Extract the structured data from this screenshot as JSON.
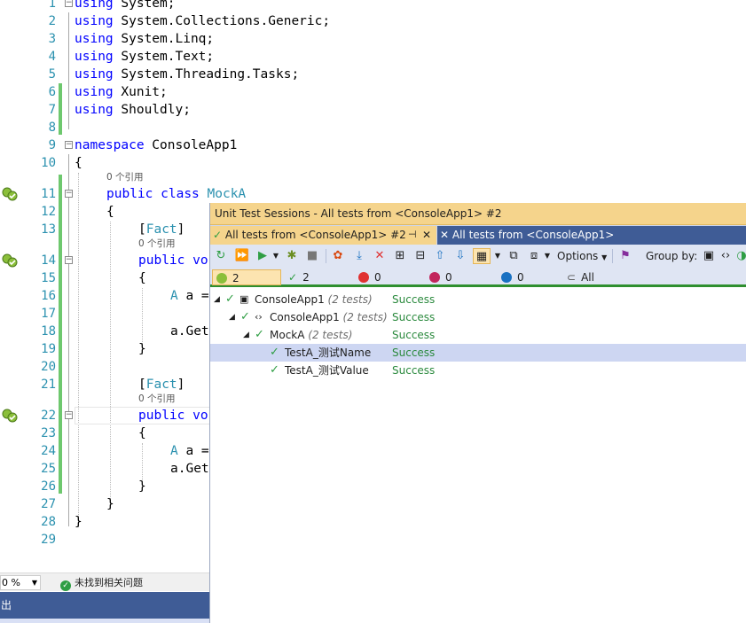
{
  "editor": {
    "lines": [
      {
        "n": "1",
        "indent": 0,
        "tokens": [
          {
            "t": "using",
            "c": "kw"
          },
          {
            "t": " System;",
            "c": ""
          }
        ]
      },
      {
        "n": "2",
        "indent": 0,
        "tokens": [
          {
            "t": "using",
            "c": "kw"
          },
          {
            "t": " System.Collections.Generic;",
            "c": ""
          }
        ]
      },
      {
        "n": "3",
        "indent": 0,
        "tokens": [
          {
            "t": "using",
            "c": "kw"
          },
          {
            "t": " System.Linq;",
            "c": ""
          }
        ]
      },
      {
        "n": "4",
        "indent": 0,
        "tokens": [
          {
            "t": "using",
            "c": "kw"
          },
          {
            "t": " System.Text;",
            "c": ""
          }
        ]
      },
      {
        "n": "5",
        "indent": 0,
        "tokens": [
          {
            "t": "using",
            "c": "kw"
          },
          {
            "t": " System.Threading.Tasks;",
            "c": ""
          }
        ]
      },
      {
        "n": "6",
        "indent": 0,
        "tokens": [
          {
            "t": "using",
            "c": "kw"
          },
          {
            "t": " Xunit;",
            "c": ""
          }
        ]
      },
      {
        "n": "7",
        "indent": 0,
        "tokens": [
          {
            "t": "using",
            "c": "kw"
          },
          {
            "t": " Shouldly;",
            "c": ""
          }
        ]
      },
      {
        "n": "8",
        "indent": 0,
        "tokens": []
      },
      {
        "n": "9",
        "indent": 0,
        "tokens": [
          {
            "t": "namespace",
            "c": "kw"
          },
          {
            "t": " ConsoleApp1",
            "c": ""
          }
        ]
      },
      {
        "n": "10",
        "indent": 0,
        "tokens": [
          {
            "t": "{",
            "c": ""
          }
        ]
      },
      {
        "n": "11",
        "indent": 1,
        "tokens": [
          {
            "t": "public",
            "c": "kw"
          },
          {
            "t": " ",
            "c": ""
          },
          {
            "t": "class",
            "c": "kw"
          },
          {
            "t": " ",
            "c": ""
          },
          {
            "t": "MockA",
            "c": "type"
          }
        ]
      },
      {
        "n": "12",
        "indent": 1,
        "tokens": [
          {
            "t": "{",
            "c": ""
          }
        ]
      },
      {
        "n": "13",
        "indent": 2,
        "tokens": [
          {
            "t": "[",
            "c": ""
          },
          {
            "t": "Fact",
            "c": "type"
          },
          {
            "t": "]",
            "c": ""
          }
        ]
      },
      {
        "n": "14",
        "indent": 2,
        "tokens": [
          {
            "t": "public",
            "c": "kw"
          },
          {
            "t": " vo",
            "c": "kw"
          }
        ]
      },
      {
        "n": "15",
        "indent": 2,
        "tokens": [
          {
            "t": "{",
            "c": ""
          }
        ]
      },
      {
        "n": "16",
        "indent": 3,
        "tokens": [
          {
            "t": "A",
            "c": "type"
          },
          {
            "t": " a =",
            "c": ""
          }
        ]
      },
      {
        "n": "17",
        "indent": 0,
        "tokens": []
      },
      {
        "n": "18",
        "indent": 3,
        "tokens": [
          {
            "t": "a.Get",
            "c": ""
          }
        ]
      },
      {
        "n": "19",
        "indent": 2,
        "tokens": [
          {
            "t": "}",
            "c": ""
          }
        ]
      },
      {
        "n": "20",
        "indent": 0,
        "tokens": []
      },
      {
        "n": "21",
        "indent": 2,
        "tokens": [
          {
            "t": "[",
            "c": ""
          },
          {
            "t": "Fact",
            "c": "type"
          },
          {
            "t": "]",
            "c": ""
          }
        ]
      },
      {
        "n": "22",
        "indent": 2,
        "tokens": [
          {
            "t": "public",
            "c": "kw"
          },
          {
            "t": " vo",
            "c": "kw"
          }
        ]
      },
      {
        "n": "23",
        "indent": 2,
        "tokens": [
          {
            "t": "{",
            "c": ""
          }
        ]
      },
      {
        "n": "24",
        "indent": 3,
        "tokens": [
          {
            "t": "A",
            "c": "type"
          },
          {
            "t": " a =",
            "c": ""
          }
        ]
      },
      {
        "n": "25",
        "indent": 3,
        "tokens": [
          {
            "t": "a.Get",
            "c": ""
          }
        ]
      },
      {
        "n": "26",
        "indent": 2,
        "tokens": [
          {
            "t": "}",
            "c": ""
          }
        ]
      },
      {
        "n": "27",
        "indent": 1,
        "tokens": [
          {
            "t": "}",
            "c": ""
          }
        ]
      },
      {
        "n": "28",
        "indent": 0,
        "tokens": [
          {
            "t": "}",
            "c": ""
          }
        ]
      },
      {
        "n": "29",
        "indent": 0,
        "tokens": []
      }
    ],
    "reference_label": "0 个引用"
  },
  "statusbar": {
    "zoom": "0 %",
    "issues": "未找到相关问题"
  },
  "outputbar": {
    "title": "出"
  },
  "unit_test": {
    "title": "Unit Test Sessions - All tests from <ConsoleApp1> #2",
    "tabs": [
      {
        "label": "All tests from <ConsoleApp1> #2"
      },
      {
        "label": "All tests from <ConsoleApp1>"
      }
    ],
    "toolbar": {
      "options_label": "Options",
      "group_by_label": "Group by:"
    },
    "filters": {
      "total": "2",
      "passed": "2",
      "failed": "0",
      "ignored": "0",
      "unknown": "0",
      "all": "All"
    },
    "tree": [
      {
        "name": "ConsoleApp1",
        "count": "(2 tests)",
        "status": "Success",
        "level": 0,
        "kind": "project",
        "selected": false
      },
      {
        "name": "ConsoleApp1",
        "count": "(2 tests)",
        "status": "Success",
        "level": 1,
        "kind": "namespace",
        "selected": false
      },
      {
        "name": "MockA",
        "count": "(2 tests)",
        "status": "Success",
        "level": 2,
        "kind": "class",
        "selected": false
      },
      {
        "name": "TestA_测试Name",
        "count": "",
        "status": "Success",
        "level": 3,
        "kind": "test",
        "selected": true
      },
      {
        "name": "TestA_测试Value",
        "count": "",
        "status": "Success",
        "level": 3,
        "kind": "test",
        "selected": false
      }
    ]
  },
  "colors": {
    "keyword": "#0000ff",
    "type": "#2b91af",
    "success": "#2b8a3e",
    "title_bar": "#f5d48c",
    "tab_inactive": "#3f5c96"
  }
}
